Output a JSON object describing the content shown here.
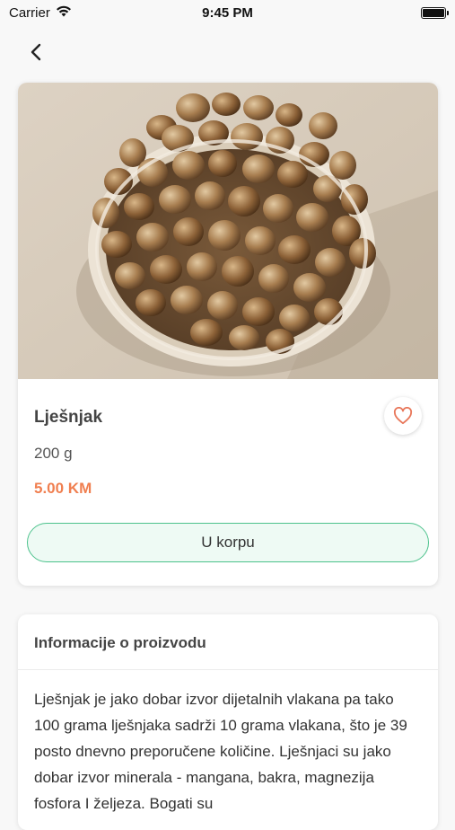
{
  "status_bar": {
    "carrier": "Carrier",
    "time": "9:45 PM"
  },
  "nav": {
    "back_icon": "chevron-left-icon"
  },
  "product": {
    "name": "Lješnjak",
    "weight": "200 g",
    "price": "5.00 KM",
    "favorite_icon": "heart-outline-icon",
    "add_to_cart_label": "U korpu"
  },
  "info": {
    "title": "Informacije o proizvodu",
    "description": "Lješnjak je jako dobar izvor dijetalnih vlakana pa tako 100 grama lješnjaka sadrži 10 grama vlakana, što je 39 posto dnevno preporučene količine. Lješnjaci su jako dobar izvor minerala - mangana, bakra, magnezija fosfora I željeza.  Bogati su"
  },
  "colors": {
    "accent_price": "#f07f50",
    "accent_button_border": "#4cc28c",
    "heart": "#e8775a"
  }
}
